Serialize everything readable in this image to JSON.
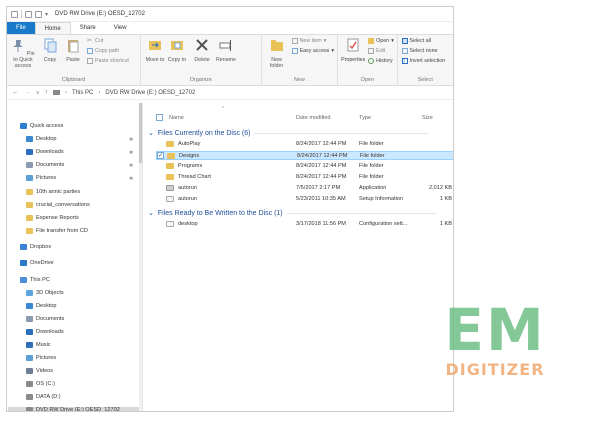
{
  "window": {
    "title": "DVD RW Drive (E:) OESD_12702"
  },
  "tabs": [
    "File",
    "Home",
    "Share",
    "View"
  ],
  "ribbon": {
    "clipboard": {
      "pin_label": "Pin to Quick access",
      "copy_label": "Copy",
      "paste_label": "Paste",
      "cut_label": "Cut",
      "copy_path_label": "Copy path",
      "paste_shortcut_label": "Paste shortcut",
      "group_label": "Clipboard"
    },
    "organize": {
      "move_to_label": "Move to",
      "copy_to_label": "Copy to",
      "delete_label": "Delete",
      "rename_label": "Rename",
      "group_label": "Organize"
    },
    "new": {
      "new_folder_label": "New folder",
      "new_item_label": "New item",
      "easy_access_label": "Easy access",
      "group_label": "New"
    },
    "open": {
      "properties_label": "Properties",
      "open_label": "Open",
      "edit_label": "Edit",
      "history_label": "History",
      "group_label": "Open"
    },
    "select": {
      "select_all_label": "Select all",
      "select_none_label": "Select none",
      "invert_selection_label": "Invert selection",
      "group_label": "Select"
    }
  },
  "address": {
    "crumbs": [
      "This PC",
      "DVD RW Drive (E:) OESD_12702"
    ]
  },
  "nav": {
    "items": [
      {
        "label": "Quick access",
        "level": 0,
        "pinned": false,
        "color": "#2f7fd1"
      },
      {
        "label": "Desktop",
        "level": 1,
        "pinned": true,
        "color": "#3a87d6"
      },
      {
        "label": "Downloads",
        "level": 1,
        "pinned": true,
        "color": "#2a6fc0"
      },
      {
        "label": "Documents",
        "level": 1,
        "pinned": true,
        "color": "#8a9bb0"
      },
      {
        "label": "Pictures",
        "level": 1,
        "pinned": true,
        "color": "#5ba1d8"
      },
      {
        "label": "10th annic parties",
        "level": 1,
        "pinned": false,
        "color": "#e9c35a"
      },
      {
        "label": "crucial_conversations",
        "level": 1,
        "pinned": false,
        "color": "#e9c35a"
      },
      {
        "label": "Expense Reports",
        "level": 1,
        "pinned": false,
        "color": "#e9c35a"
      },
      {
        "label": "File transfer from CD",
        "level": 1,
        "pinned": false,
        "color": "#e9c35a"
      },
      {
        "label": "Dropbox",
        "level": 0,
        "pinned": false,
        "color": "#3b82d6"
      },
      {
        "label": "OneDrive",
        "level": 0,
        "pinned": false,
        "color": "#2b78c6"
      },
      {
        "label": "This PC",
        "level": 0,
        "pinned": false,
        "color": "#4a8fd4"
      },
      {
        "label": "3D Objects",
        "level": 1,
        "pinned": false,
        "color": "#5fa3de"
      },
      {
        "label": "Desktop",
        "level": 1,
        "pinned": false,
        "color": "#3a87d6"
      },
      {
        "label": "Documents",
        "level": 1,
        "pinned": false,
        "color": "#8a9bb0"
      },
      {
        "label": "Downloads",
        "level": 1,
        "pinned": false,
        "color": "#2a6fc0"
      },
      {
        "label": "Music",
        "level": 1,
        "pinned": false,
        "color": "#2f6fb8"
      },
      {
        "label": "Pictures",
        "level": 1,
        "pinned": false,
        "color": "#5ba1d8"
      },
      {
        "label": "Videos",
        "level": 1,
        "pinned": false,
        "color": "#6f7f95"
      },
      {
        "label": "OS (C:)",
        "level": 1,
        "pinned": false,
        "color": "#8a8a8a"
      },
      {
        "label": "DATA (D:)",
        "level": 1,
        "pinned": false,
        "color": "#8a8a8a"
      },
      {
        "label": "DVD RW Drive (E:) OESD_12702",
        "level": 1,
        "pinned": false,
        "color": "#8a8a8a",
        "selected": true
      }
    ]
  },
  "columns": {
    "name": "Name",
    "date": "Date modified",
    "type": "Type",
    "size": "Size"
  },
  "groups": [
    {
      "title": "Files Currently on the Disc (6)",
      "rows": [
        {
          "name": "AutoPlay",
          "date": "8/24/2017 12:44 PM",
          "type": "File folder",
          "size": "",
          "icon": "folder"
        },
        {
          "name": "Designs",
          "date": "8/24/2017 12:44 PM",
          "type": "File folder",
          "size": "",
          "icon": "folder",
          "selected": true
        },
        {
          "name": "Programs",
          "date": "8/24/2017 12:44 PM",
          "type": "File folder",
          "size": "",
          "icon": "folder"
        },
        {
          "name": "Thread Chart",
          "date": "8/24/2017 12:44 PM",
          "type": "File folder",
          "size": "",
          "icon": "folder"
        },
        {
          "name": "autorun",
          "date": "7/5/2017 2:17 PM",
          "type": "Application",
          "size": "2,012 KB",
          "icon": "app"
        },
        {
          "name": "autorun",
          "date": "5/23/2011 10:35 AM",
          "type": "Setup Information",
          "size": "1 KB",
          "icon": "file"
        }
      ]
    },
    {
      "title": "Files Ready to Be Written to the Disc (1)",
      "rows": [
        {
          "name": "desktop",
          "date": "3/17/2018 11:56 PM",
          "type": "Configuration sett...",
          "size": "1 KB",
          "icon": "file"
        }
      ]
    }
  ],
  "watermark": {
    "line1": "EM",
    "line2": "DIGITIZER"
  }
}
